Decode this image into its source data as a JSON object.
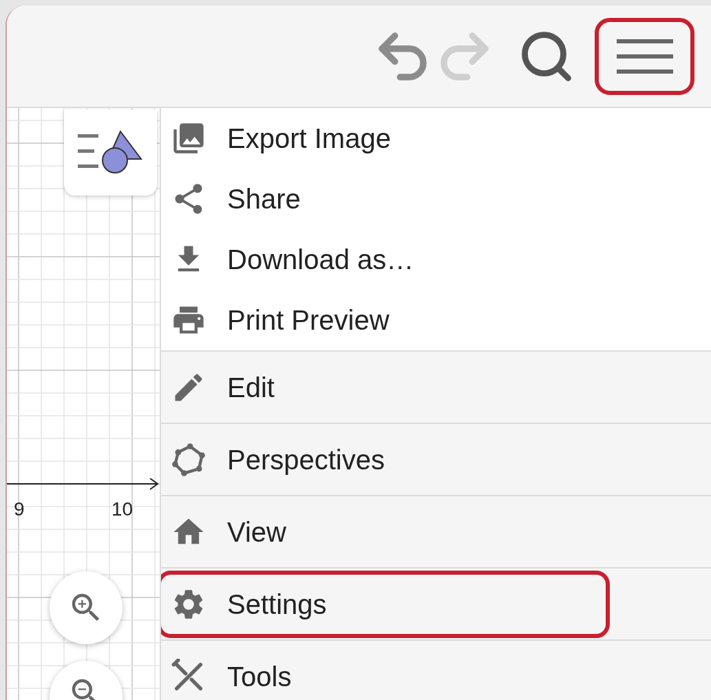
{
  "toolbar": {
    "undo": {
      "disabled": false
    },
    "redo": {
      "disabled": true
    },
    "menu_button": {
      "highlighted": true
    }
  },
  "graph": {
    "axis_labels": [
      "9",
      "10"
    ]
  },
  "menu": {
    "sections": [
      {
        "kind": "actions",
        "items": [
          {
            "label": "Export Image",
            "highlighted": false
          },
          {
            "label": "Share",
            "highlighted": false
          },
          {
            "label": "Download as…",
            "highlighted": false
          },
          {
            "label": "Print Preview",
            "highlighted": false
          }
        ]
      },
      {
        "kind": "categories",
        "items": [
          {
            "label": "Edit",
            "highlighted": false
          },
          {
            "label": "Perspectives",
            "highlighted": false
          },
          {
            "label": "View",
            "highlighted": false
          },
          {
            "label": "Settings",
            "highlighted": true
          },
          {
            "label": "Tools",
            "highlighted": false
          }
        ]
      }
    ]
  }
}
